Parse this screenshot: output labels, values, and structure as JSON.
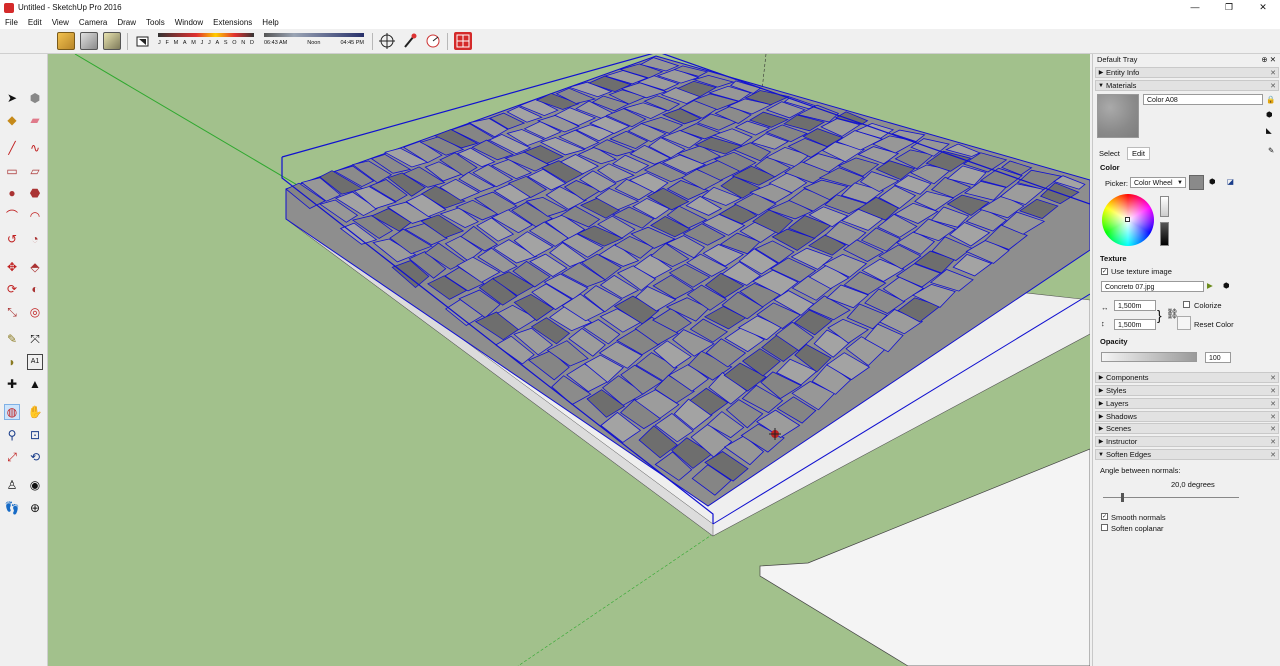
{
  "window": {
    "title": "Untitled - SketchUp Pro 2016",
    "controls": [
      "—",
      "❐",
      "✕"
    ]
  },
  "menu": [
    "File",
    "Edit",
    "View",
    "Camera",
    "Draw",
    "Tools",
    "Window",
    "Extensions",
    "Help"
  ],
  "shadows": {
    "months": "J F M A M J J A S O N D",
    "time_start": "06:43 AM",
    "time_mid": "Noon",
    "time_end": "04:45 PM"
  },
  "tray": {
    "title": "Default Tray",
    "panels": {
      "entity_info": "Entity Info",
      "materials": "Materials",
      "components": "Components",
      "styles": "Styles",
      "layers": "Layers",
      "shadows": "Shadows",
      "scenes": "Scenes",
      "instructor": "Instructor",
      "soften_edges": "Soften Edges"
    },
    "materials": {
      "name": "Color A08",
      "tab_select": "Select",
      "tab_edit": "Edit",
      "color_heading": "Color",
      "picker_label": "Picker:",
      "picker_value": "Color Wheel",
      "texture_heading": "Texture",
      "use_texture_label": "Use texture image",
      "use_texture_checked": true,
      "texture_file": "Concreto 07.jpg",
      "width": "1,500m",
      "height": "1,500m",
      "colorize_label": "Colorize",
      "reset_color_label": "Reset Color",
      "opacity_heading": "Opacity",
      "opacity_value": "100"
    },
    "soften": {
      "angle_label": "Angle between normals:",
      "angle_value": "20,0  degrees",
      "smooth_label": "Smooth normals",
      "smooth_checked": true,
      "coplanar_label": "Soften coplanar",
      "coplanar_checked": false
    }
  },
  "colors": {
    "viewport_bg": "#a2c18c",
    "selection_edge": "#1010d0",
    "block_face": "#8e8e8e",
    "slab": "#efefef"
  }
}
